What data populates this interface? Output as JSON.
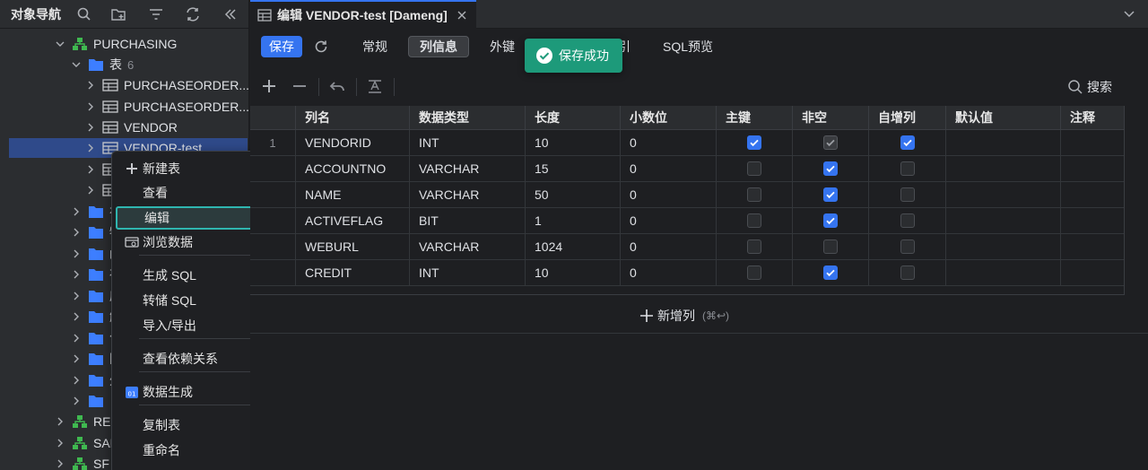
{
  "navigator": {
    "title": "对象导航",
    "tree": [
      {
        "label": "PURCHASING",
        "kind": "schema",
        "expanded": true
      },
      {
        "label": "表",
        "count": "6",
        "kind": "folder",
        "expanded": true
      },
      {
        "label": "PURCHASEORDER...",
        "kind": "table"
      },
      {
        "label": "PURCHASEORDER...",
        "kind": "table"
      },
      {
        "label": "VENDOR",
        "kind": "table"
      },
      {
        "label": "VENDOR-test",
        "kind": "table",
        "selected": true
      },
      {
        "label": "",
        "kind": "table"
      },
      {
        "label": "",
        "kind": "table"
      },
      {
        "label": "视",
        "kind": "folder"
      },
      {
        "label": "物",
        "kind": "folder"
      },
      {
        "label": "函",
        "kind": "folder"
      },
      {
        "label": "存",
        "kind": "folder"
      },
      {
        "label": "序",
        "kind": "folder"
      },
      {
        "label": "触",
        "kind": "folder"
      },
      {
        "label": "包",
        "kind": "folder"
      },
      {
        "label": "同",
        "kind": "folder"
      },
      {
        "label": "外",
        "kind": "folder"
      },
      {
        "label": "自",
        "kind": "folder"
      },
      {
        "label": "RES",
        "kind": "schema"
      },
      {
        "label": "SAL",
        "kind": "schema"
      },
      {
        "label": "SF",
        "kind": "schema"
      }
    ]
  },
  "context_menu": {
    "items": [
      {
        "label": "新建表",
        "icon": "plus-icon"
      },
      {
        "label": "查看"
      },
      {
        "label": "编辑",
        "highlighted": true
      },
      {
        "label": "浏览数据",
        "icon": "browse-data-icon"
      },
      {
        "label": "生成 SQL",
        "submenu": true
      },
      {
        "label": "转储 SQL",
        "submenu": true
      },
      {
        "label": "导入/导出",
        "submenu": true
      },
      {
        "label": "查看依赖关系"
      },
      {
        "label": "数据生成",
        "icon": "data-generate-icon"
      },
      {
        "label": "复制表"
      },
      {
        "label": "重命名"
      }
    ]
  },
  "tab": {
    "label": "编辑 VENDOR-test [Dameng]"
  },
  "toolbar": {
    "save_label": "保存",
    "tabs": [
      "常规",
      "列信息",
      "外键",
      "SQL预览"
    ],
    "active_tab": "列信息",
    "search_label": "搜索"
  },
  "toast": {
    "message": "保存成功"
  },
  "columns_table": {
    "headers": [
      "列名",
      "数据类型",
      "长度",
      "小数位",
      "主键",
      "非空",
      "自增列",
      "默认值",
      "注释"
    ],
    "rows": [
      {
        "num": "1",
        "name": "VENDORID",
        "type": "INT",
        "length": "10",
        "scale": "0",
        "pk": "on",
        "notnull": "disabled",
        "autoinc": "on"
      },
      {
        "num": "",
        "name": "ACCOUNTNO",
        "type": "VARCHAR",
        "length": "15",
        "scale": "0",
        "pk": "off",
        "notnull": "on",
        "autoinc": "off"
      },
      {
        "num": "",
        "name": "NAME",
        "type": "VARCHAR",
        "length": "50",
        "scale": "0",
        "pk": "off",
        "notnull": "on",
        "autoinc": "off"
      },
      {
        "num": "",
        "name": "ACTIVEFLAG",
        "type": "BIT",
        "length": "1",
        "scale": "0",
        "pk": "off",
        "notnull": "on",
        "autoinc": "off"
      },
      {
        "num": "",
        "name": "WEBURL",
        "type": "VARCHAR",
        "length": "1024",
        "scale": "0",
        "pk": "off",
        "notnull": "off",
        "autoinc": "off"
      },
      {
        "num": "",
        "name": "CREDIT",
        "type": "INT",
        "length": "10",
        "scale": "0",
        "pk": "off",
        "notnull": "on",
        "autoinc": "off"
      }
    ]
  },
  "add_column": {
    "label": "新增列",
    "shortcut": "(⌘↩)"
  },
  "colors": {
    "accent": "#3574f0",
    "toast": "#1d9a7a",
    "highlight_border": "#2fb6b0",
    "selection": "#2f4a8a"
  }
}
